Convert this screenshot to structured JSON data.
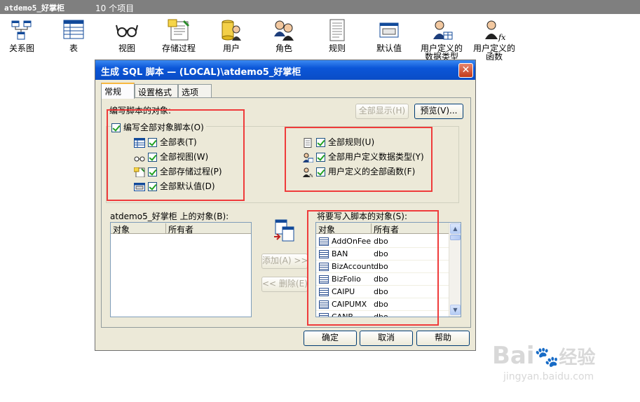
{
  "topbar": {
    "db_title": "atdemo5_好掌柜",
    "item_count": "10 个项目"
  },
  "toolbar": [
    {
      "label": "关系图",
      "icon": "diagram-icon"
    },
    {
      "label": "表",
      "icon": "table-icon"
    },
    {
      "label": "视图",
      "icon": "glasses-view-icon"
    },
    {
      "label": "存储过程",
      "icon": "stored-procedure-icon"
    },
    {
      "label": "用户",
      "icon": "user-icon"
    },
    {
      "label": "角色",
      "icon": "role-icon"
    },
    {
      "label": "规则",
      "icon": "rule-icon"
    },
    {
      "label": "默认值",
      "icon": "default-icon"
    },
    {
      "label": "用户定义的数据类型",
      "label_line1": "用户定义的",
      "label_line2": "数据类型",
      "icon": "udt-icon"
    },
    {
      "label": "用户定义的函数",
      "label_line1": "用户定义的",
      "label_line2": "函数",
      "icon": "udf-icon"
    }
  ],
  "dialog": {
    "title": "生成 SQL 脚本 — (LOCAL)\\atdemo5_好掌柜",
    "close_icon": "close-icon",
    "tabs": [
      "常规",
      "设置格式",
      "选项"
    ],
    "objects_label": "编写脚本的对象:",
    "show_all_button": "全部显示(H)",
    "preview_button": "预览(V)...",
    "script_all": "编写全部对象脚本(O)",
    "left_checks": [
      {
        "label": "全部表(T)",
        "icon": "table-icon"
      },
      {
        "label": "全部视图(W)",
        "icon": "glasses-view-icon"
      },
      {
        "label": "全部存储过程(P)",
        "icon": "stored-procedure-icon"
      },
      {
        "label": "全部默认值(D)",
        "icon": "default-icon"
      }
    ],
    "right_checks": [
      {
        "label": "全部规则(U)",
        "icon": "rule-icon"
      },
      {
        "label": "全部用户定义数据类型(Y)",
        "icon": "udt-icon"
      },
      {
        "label": "用户定义的全部函数(F)",
        "icon": "udf-icon"
      }
    ],
    "source_list": {
      "label": "atdemo5_好掌柜 上的对象(B):",
      "columns": [
        "对象",
        "所有者"
      ]
    },
    "add_button": "添加(A) >>",
    "remove_button": "<< 删除(E)",
    "target_list": {
      "label": "将要写入脚本的对象(S):",
      "columns": [
        "对象",
        "所有者"
      ],
      "rows": [
        {
          "name": "AddOnFee",
          "owner": "dbo"
        },
        {
          "name": "BAN",
          "owner": "dbo"
        },
        {
          "name": "BizAccount",
          "owner": "dbo"
        },
        {
          "name": "BizFolio",
          "owner": "dbo"
        },
        {
          "name": "CAIPU",
          "owner": "dbo"
        },
        {
          "name": "CAIPUMX",
          "owner": "dbo"
        },
        {
          "name": "CANB",
          "owner": "dbo"
        }
      ]
    },
    "ok_button": "确定",
    "cancel_button": "取消",
    "help_button": "帮助"
  },
  "watermark": {
    "brand": "Bai",
    "brand2": "经验",
    "url": "jingyan.baidu.com"
  },
  "colors": {
    "title_bar": "#0b56d8",
    "dialog_bg": "#ece9d8",
    "highlight_box": "#ef3b3b"
  }
}
